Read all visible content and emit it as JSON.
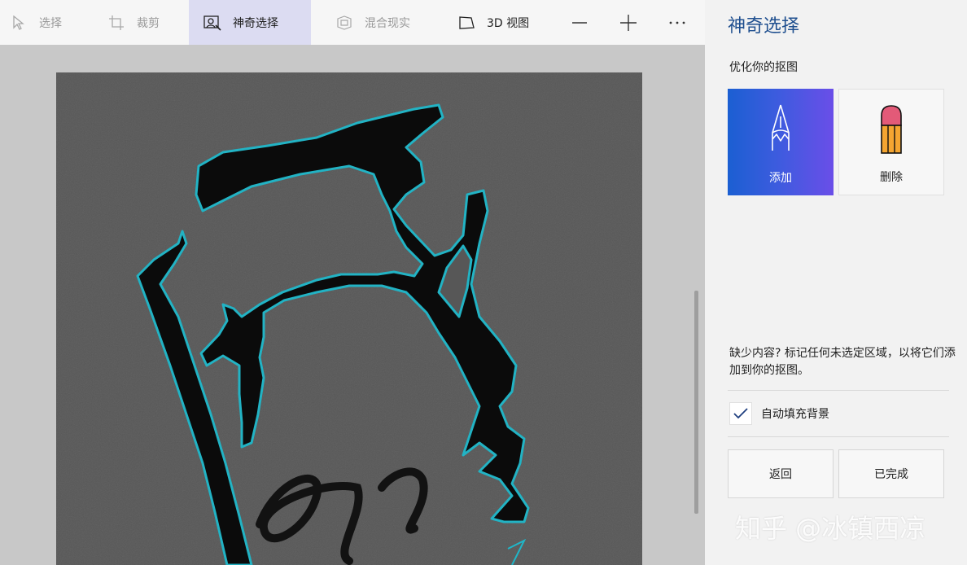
{
  "toolbar": {
    "select_label": "选择",
    "crop_label": "裁剪",
    "magic_select_label": "神奇选择",
    "mixed_reality_label": "混合现实",
    "view3d_label": "3D 视图"
  },
  "panel": {
    "title": "神奇选择",
    "subtitle": "优化你的抠图",
    "add_label": "添加",
    "delete_label": "删除",
    "hint_text": "缺少内容? 标记任何未选定区域，以将它们添加到你的抠图。",
    "autofill_label": "自动填充背景",
    "autofill_checked": true,
    "back_label": "返回",
    "done_label": "已完成"
  },
  "watermark": "知乎 @冰镇西凉",
  "colors": {
    "accent": "#1f4f8f",
    "active_tab": "#dcdcf2",
    "selection_outline": "#1fb6c8"
  }
}
